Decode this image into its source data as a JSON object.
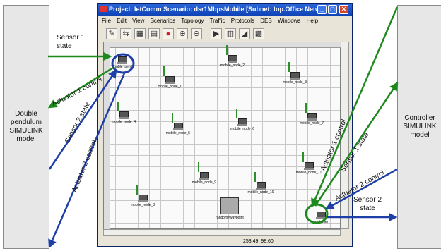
{
  "left_block": {
    "label": "Double\npendulum\nSIMULINK\nmodel"
  },
  "right_block": {
    "label": "Controller\nSIMULINK\nmodel"
  },
  "window": {
    "title": "Project: letComm Scenario: dsr1MbpsMobile  [Subnet: top.Office Netw...",
    "menu": [
      "File",
      "Edit",
      "View",
      "Scenarios",
      "Topology",
      "Traffic",
      "Protocols",
      "DES",
      "Windows",
      "Help"
    ],
    "status": "253.49, 98.60"
  },
  "nodes": [
    {
      "label": "mobile_node_2"
    },
    {
      "label": "mobile_node_3"
    },
    {
      "label": "mobile_node_1"
    },
    {
      "label": "mobile_node_4"
    },
    {
      "label": "mobile_node_5"
    },
    {
      "label": "mobile_node_6"
    },
    {
      "label": "mobile_node_7"
    },
    {
      "label": "mobile_node_11"
    },
    {
      "label": "mobile_node_9"
    },
    {
      "label": "mobile_node_10"
    },
    {
      "label": "mobile_node_8"
    },
    {
      "label": "double_pend"
    },
    {
      "label": "controller"
    }
  ],
  "random_waypoint": {
    "label": "random#waypoint"
  },
  "links": [
    {
      "label": "Sensor 1\nstate",
      "color": "#1e8a1e"
    },
    {
      "label": "Actuator 1 control",
      "color": "#1e8a1e"
    },
    {
      "label": "Sensor 2 state",
      "color": "#1f3fa8"
    },
    {
      "label": "Actuator 2 control",
      "color": "#1f3fa8"
    },
    {
      "label": "Actuator 1 control",
      "color": "#1e8a1e"
    },
    {
      "label": "Sensor 1 state",
      "color": "#1e8a1e"
    },
    {
      "label": "Actuator 2 control",
      "color": "#1f3fa8"
    },
    {
      "label": "Sensor 2\nstate",
      "color": "#1f3fa8"
    }
  ]
}
